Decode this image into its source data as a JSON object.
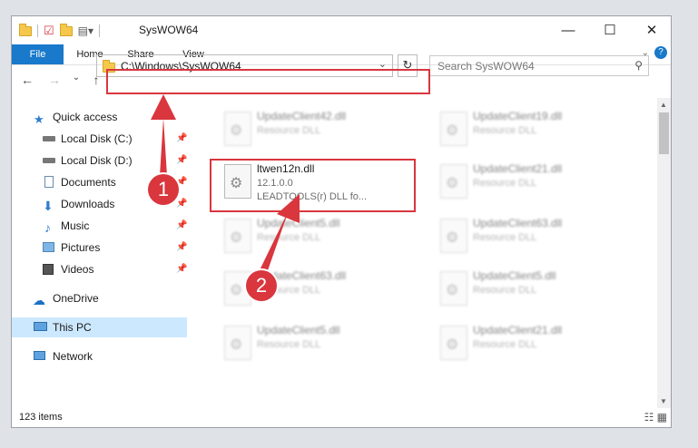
{
  "window": {
    "title": "SysWOW64"
  },
  "window_controls": {
    "minimize": "—",
    "maximize": "☐",
    "close": "✕"
  },
  "ribbon": {
    "tabs": [
      "File",
      "Home",
      "Share",
      "View"
    ]
  },
  "nav": {
    "back": "←",
    "forward": "→",
    "recent": "⌄",
    "up": "↑"
  },
  "address": {
    "path": "C:\\Windows\\SysWOW64",
    "dropdown": "⌄",
    "refresh": "↻"
  },
  "search": {
    "placeholder": "Search SysWOW64",
    "icon": "⚲"
  },
  "sidebar": {
    "items": [
      {
        "label": "Quick access",
        "icon": "star-icon",
        "pinned": false
      },
      {
        "label": "Local Disk (C:)",
        "icon": "drive-icon",
        "pinned": true
      },
      {
        "label": "Local Disk (D:)",
        "icon": "drive-icon",
        "pinned": true
      },
      {
        "label": "Documents",
        "icon": "documents-icon",
        "pinned": true
      },
      {
        "label": "Downloads",
        "icon": "downloads-icon",
        "pinned": true
      },
      {
        "label": "Music",
        "icon": "music-icon",
        "pinned": true
      },
      {
        "label": "Pictures",
        "icon": "pictures-icon",
        "pinned": true
      },
      {
        "label": "Videos",
        "icon": "videos-icon",
        "pinned": true
      },
      {
        "label": "OneDrive",
        "icon": "onedrive-icon",
        "pinned": false
      },
      {
        "label": "This PC",
        "icon": "pc-icon",
        "pinned": false,
        "selected": true
      },
      {
        "label": "Network",
        "icon": "network-icon",
        "pinned": false
      }
    ]
  },
  "files": {
    "highlighted": {
      "name": "ltwen12n.dll",
      "version": "12.1.0.0",
      "description": "LEADTOOLS(r) DLL fo..."
    },
    "items": [
      {
        "name": "UpdateClient42.dll",
        "type": "Resource DLL"
      },
      {
        "name": "UpdateClient19.dll",
        "type": "Resource DLL"
      },
      {
        "name": "UpdateClient21.dll",
        "type": "Resource DLL"
      },
      {
        "name": "UpdateClient5.dll",
        "type": "Resource DLL"
      },
      {
        "name": "UpdateClient63.dll",
        "type": "Resource DLL"
      },
      {
        "name": "UpdateClient63.dll",
        "type": "Resource DLL"
      },
      {
        "name": "UpdateClient5.dll",
        "type": "Resource DLL"
      },
      {
        "name": "UpdateClient5.dll",
        "type": "Resource DLL"
      },
      {
        "name": "UpdateClient21.dll",
        "type": "Resource DLL"
      }
    ]
  },
  "status": {
    "count": "123 items",
    "view_icons": "☷ ▦"
  },
  "annotations": {
    "step1": "1",
    "step2": "2",
    "color": "#d9363e"
  }
}
